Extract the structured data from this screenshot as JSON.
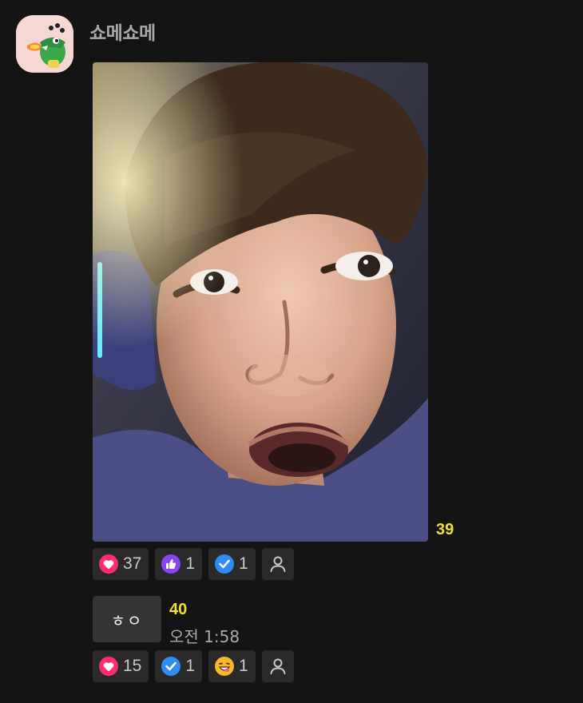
{
  "sender": {
    "name": "쇼메쇼메",
    "avatar_icon": "crocodile-sticker-icon"
  },
  "messages": [
    {
      "type": "photo",
      "unread_count": "39",
      "reactions": [
        {
          "icon": "heart-icon",
          "color": "#ff2e74",
          "count": "37"
        },
        {
          "icon": "thumbs-up-icon",
          "color": "#8a44f2",
          "count": "1"
        },
        {
          "icon": "check-icon",
          "color": "#2f8cf3",
          "count": "1"
        }
      ]
    },
    {
      "type": "text",
      "text": "ㅎㅇ",
      "unread_count": "40",
      "time": "오전 1:58",
      "reactions": [
        {
          "icon": "heart-icon",
          "color": "#ff2e74",
          "count": "15"
        },
        {
          "icon": "check-icon",
          "color": "#2f8cf3",
          "count": "1"
        },
        {
          "icon": "grinning-face-icon",
          "color": "#f6b92b",
          "count": "1"
        }
      ]
    }
  ],
  "colors": {
    "unread": "#f0e130",
    "background": "#141414",
    "chip": "#2a2a2a"
  }
}
